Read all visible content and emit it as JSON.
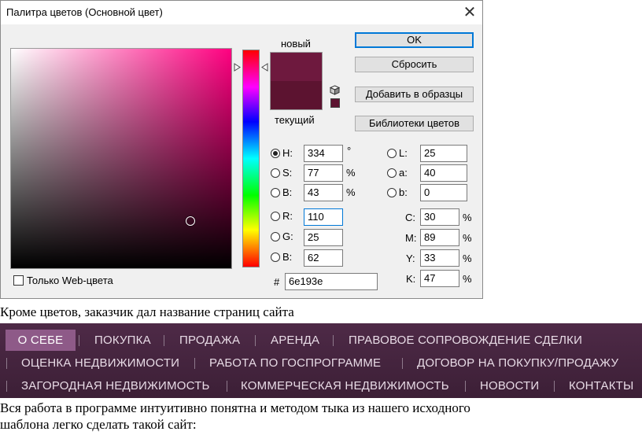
{
  "dialog": {
    "title": "Палитра цветов (Основной цвет)",
    "close": "✕",
    "new_label": "новый",
    "current_label": "текущий",
    "buttons": {
      "ok": "OK",
      "reset": "Сбросить",
      "add_swatches": "Добавить в образцы",
      "libraries": "Библиотеки цветов"
    },
    "web_only_label": "Только Web-цвета",
    "fields": {
      "H": {
        "label": "H:",
        "value": "334",
        "unit": "°"
      },
      "S": {
        "label": "S:",
        "value": "77",
        "unit": "%"
      },
      "B": {
        "label": "B:",
        "value": "43",
        "unit": "%"
      },
      "R": {
        "label": "R:",
        "value": "110"
      },
      "G": {
        "label": "G:",
        "value": "25"
      },
      "Bb": {
        "label": "B:",
        "value": "62"
      },
      "L": {
        "label": "L:",
        "value": "25"
      },
      "a": {
        "label": "a:",
        "value": "40"
      },
      "b": {
        "label": "b:",
        "value": "0"
      },
      "C": {
        "label": "C:",
        "value": "30",
        "unit": "%"
      },
      "M": {
        "label": "M:",
        "value": "89",
        "unit": "%"
      },
      "Y": {
        "label": "Y:",
        "value": "33",
        "unit": "%"
      },
      "K": {
        "label": "K:",
        "value": "47",
        "unit": "%"
      },
      "hex": {
        "label": "#",
        "value": "6e193e"
      }
    },
    "colors": {
      "new": "#6e193e",
      "current": "#5c1330",
      "accent": "#0078d7"
    }
  },
  "text": {
    "line1": "Кроме цветов, заказчик дал название страниц сайта",
    "line2": "Вся работа в программе интуитивно понятна и методом тыка из нашего исходного",
    "line3": "шаблона легко сделать такой сайт:"
  },
  "menu": {
    "row1": [
      "О СЕБЕ",
      "ПОКУПКА",
      "ПРОДАЖА",
      "АРЕНДА",
      "ПРАВОВОЕ СОПРОВОЖДЕНИЕ СДЕЛКИ"
    ],
    "row2": [
      "ОЦЕНКА НЕДВИЖИМОСТИ",
      "РАБОТА ПО ГОСПРОГРАММЕ",
      "ДОГОВОР НА ПОКУПКУ/ПРОДАЖУ"
    ],
    "row3": [
      "ЗАГОРОДНАЯ НЕДВИЖИМОСТЬ",
      "КОММЕРЧЕСКАЯ НЕДВИЖИМОСТЬ",
      "НОВОСТИ",
      "КОНТАКТЫ"
    ],
    "colors": {
      "background": "#4e2a47",
      "active": "#8e5a88",
      "text": "#e8dbe6"
    }
  }
}
